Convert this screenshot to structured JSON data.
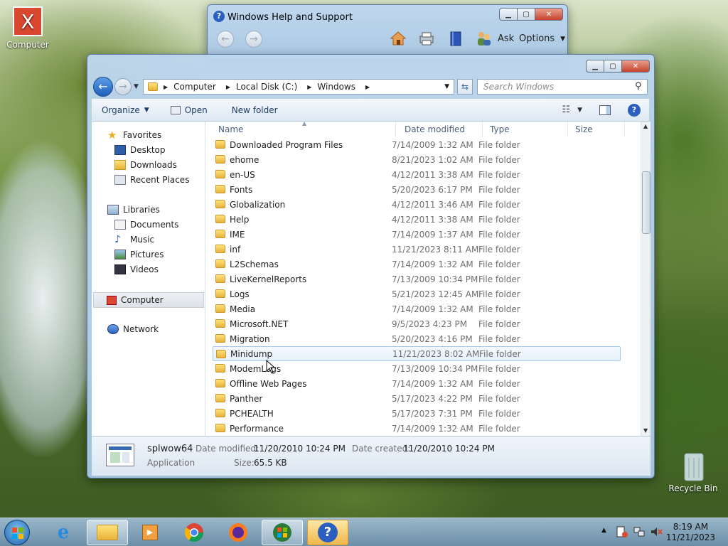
{
  "desktop": {
    "computer_label": "Computer",
    "recycle_label": "Recycle Bin"
  },
  "help_window": {
    "title": "Windows Help and Support",
    "ask_label": "Ask",
    "options_label": "Options"
  },
  "explorer": {
    "breadcrumbs": [
      "Computer",
      "Local Disk (C:)",
      "Windows"
    ],
    "search_placeholder": "Search Windows",
    "toolbar": {
      "organize": "Organize",
      "open": "Open",
      "new_folder": "New folder"
    },
    "nav": {
      "favorites": "Favorites",
      "desktop": "Desktop",
      "downloads": "Downloads",
      "recent": "Recent Places",
      "libraries": "Libraries",
      "documents": "Documents",
      "music": "Music",
      "pictures": "Pictures",
      "videos": "Videos",
      "computer": "Computer",
      "network": "Network"
    },
    "columns": [
      "Name",
      "Date modified",
      "Type",
      "Size"
    ],
    "rows": [
      {
        "name": "Downloaded Program Files",
        "date": "7/14/2009 1:32 AM",
        "type": "File folder"
      },
      {
        "name": "ehome",
        "date": "8/21/2023 1:02 AM",
        "type": "File folder"
      },
      {
        "name": "en-US",
        "date": "4/12/2011 3:38 AM",
        "type": "File folder"
      },
      {
        "name": "Fonts",
        "date": "5/20/2023 6:17 PM",
        "type": "File folder"
      },
      {
        "name": "Globalization",
        "date": "4/12/2011 3:46 AM",
        "type": "File folder"
      },
      {
        "name": "Help",
        "date": "4/12/2011 3:38 AM",
        "type": "File folder"
      },
      {
        "name": "IME",
        "date": "7/14/2009 1:37 AM",
        "type": "File folder"
      },
      {
        "name": "inf",
        "date": "11/21/2023 8:11 AM",
        "type": "File folder"
      },
      {
        "name": "L2Schemas",
        "date": "7/14/2009 1:32 AM",
        "type": "File folder"
      },
      {
        "name": "LiveKernelReports",
        "date": "7/13/2009 10:34 PM",
        "type": "File folder"
      },
      {
        "name": "Logs",
        "date": "5/21/2023 12:45 AM",
        "type": "File folder"
      },
      {
        "name": "Media",
        "date": "7/14/2009 1:32 AM",
        "type": "File folder"
      },
      {
        "name": "Microsoft.NET",
        "date": "9/5/2023 4:23 PM",
        "type": "File folder"
      },
      {
        "name": "Migration",
        "date": "5/20/2023 4:16 PM",
        "type": "File folder"
      },
      {
        "name": "Minidump",
        "date": "11/21/2023 8:02 AM",
        "type": "File folder"
      },
      {
        "name": "ModemLogs",
        "date": "7/13/2009 10:34 PM",
        "type": "File folder"
      },
      {
        "name": "Offline Web Pages",
        "date": "7/14/2009 1:32 AM",
        "type": "File folder"
      },
      {
        "name": "Panther",
        "date": "5/17/2023 4:22 PM",
        "type": "File folder"
      },
      {
        "name": "PCHEALTH",
        "date": "5/17/2023 7:31 PM",
        "type": "File folder"
      },
      {
        "name": "Performance",
        "date": "7/14/2009 1:32 AM",
        "type": "File folder"
      }
    ],
    "details": {
      "name": "splwow64",
      "kind": "Application",
      "modified_label": "Date modified:",
      "modified_value": "11/20/2010 10:24 PM",
      "created_label": "Date created:",
      "created_value": "11/20/2010 10:24 PM",
      "size_label": "Size:",
      "size_value": "65.5 KB"
    }
  },
  "taskbar": {
    "time": "8:19 AM",
    "date": "11/21/2023"
  }
}
